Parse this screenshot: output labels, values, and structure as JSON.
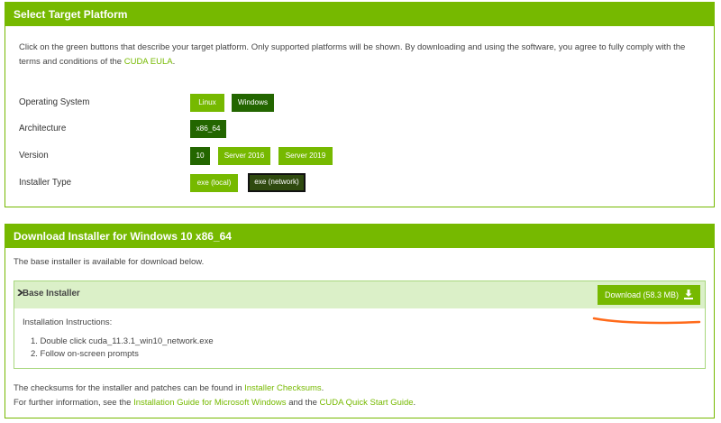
{
  "platform": {
    "title": "Select Target Platform",
    "intro_text": "Click on the green buttons that describe your target platform. Only supported platforms will be shown. By downloading and using the software, you agree to fully comply with the terms and conditions of the",
    "eula_link": "CUDA EULA",
    "eula_tail": ".",
    "rows": {
      "os": {
        "label": "Operating System",
        "options": [
          "Linux",
          "Windows"
        ],
        "selected": "Windows"
      },
      "arch": {
        "label": "Architecture",
        "options": [
          "x86_64"
        ],
        "selected": "x86_64"
      },
      "version": {
        "label": "Version",
        "options": [
          "10",
          "Server 2016",
          "Server 2019"
        ],
        "selected": "10"
      },
      "installer": {
        "label": "Installer Type",
        "options": [
          "exe (local)",
          "exe (network)"
        ],
        "selected": "exe (network)"
      }
    }
  },
  "download": {
    "title": "Download Installer for Windows 10 x86_64",
    "intro": "The base installer is available for download below.",
    "base_installer": {
      "label": "Base Installer",
      "button": "Download (58.3 MB)",
      "instructions_heading": "Installation Instructions:",
      "steps": [
        "1. Double click cuda_11.3.1_win10_network.exe",
        "2. Follow on-screen prompts"
      ]
    },
    "footer": {
      "checksums_pre": "The checksums for the installer and patches can be found in",
      "checksums_link": "Installer Checksums",
      "checksums_post": ".",
      "info_pre": "For further information, see the",
      "guide_link": "Installation Guide for Microsoft Windows",
      "info_mid": "and the",
      "quickstart_link": "CUDA Quick Start Guide",
      "info_post": "."
    }
  },
  "colors": {
    "accent": "#76b900",
    "selected": "#236600",
    "annotation": "#ff6a1a"
  }
}
